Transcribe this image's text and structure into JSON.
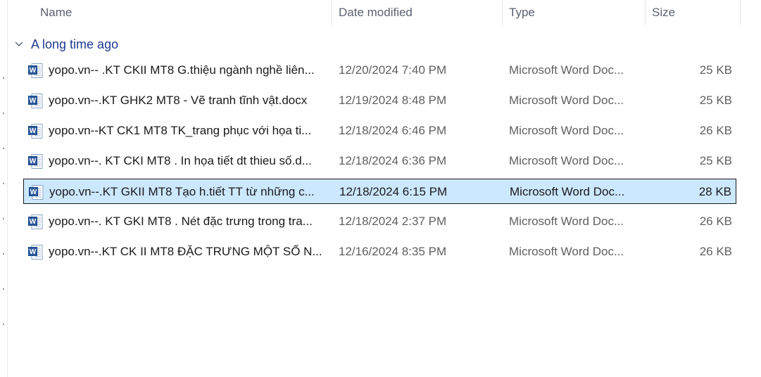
{
  "columns": {
    "name": "Name",
    "date_modified": "Date modified",
    "type": "Type",
    "size": "Size"
  },
  "group": {
    "label": "A long time ago",
    "expanded": true
  },
  "files": [
    {
      "name": "yopo.vn-- .KT CKII MT8 G.thiệu ngành nghề liên...",
      "date": "12/20/2024 7:40 PM",
      "type": "Microsoft Word Doc...",
      "size": "25 KB",
      "selected": false
    },
    {
      "name": "yopo.vn--.KT GHK2 MT8 - Vẽ tranh tĩnh vật.docx",
      "date": "12/19/2024 8:48 PM",
      "type": "Microsoft Word Doc...",
      "size": "25 KB",
      "selected": false
    },
    {
      "name": "yopo.vn--KT CK1 MT8 TK_trang phục với họa ti...",
      "date": "12/18/2024 6:46 PM",
      "type": "Microsoft Word Doc...",
      "size": "26 KB",
      "selected": false
    },
    {
      "name": "yopo.vn--. KT CKI MT8 . In họa tiết dt thieu số.d...",
      "date": "12/18/2024 6:36 PM",
      "type": "Microsoft Word Doc...",
      "size": "25 KB",
      "selected": false
    },
    {
      "name": "yopo.vn--.KT GKII MT8 Tạo h.tiết TT từ những c...",
      "date": "12/18/2024 6:15 PM",
      "type": "Microsoft Word Doc...",
      "size": "28 KB",
      "selected": true
    },
    {
      "name": "yopo.vn--. KT GKI MT8 . Nét đặc trưng trong tra...",
      "date": "12/18/2024 2:37 PM",
      "type": "Microsoft Word Doc...",
      "size": "26 KB",
      "selected": false
    },
    {
      "name": "yopo.vn--.KT CK II MT8 ĐẶC TRƯNG MỘT SỐ N...",
      "date": "12/16/2024 8:35 PM",
      "type": "Microsoft Word Doc...",
      "size": "26 KB",
      "selected": false
    }
  ],
  "icon": "word-document-icon",
  "colors": {
    "selection_bg": "#cce8ff",
    "group_text": "#1f3a93",
    "word_blue": "#2b579a"
  }
}
